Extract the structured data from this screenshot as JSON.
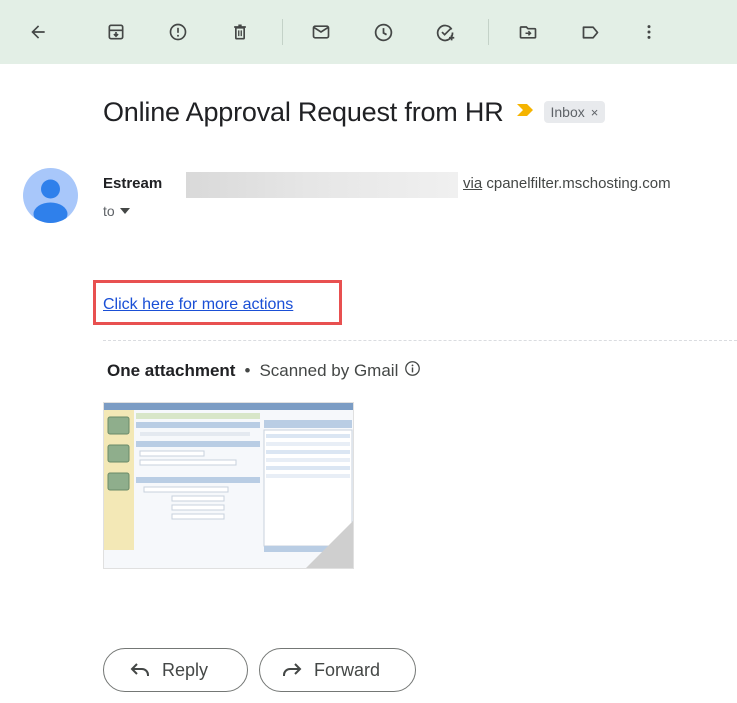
{
  "email": {
    "subject": "Online Approval Request from HR",
    "label": "Inbox",
    "label_close": "×",
    "sender_name": "Estream",
    "via_word": "via",
    "via_domain": "cpanelfilter.mschosting.com",
    "to_label": "to",
    "body_link": "Click here for more actions"
  },
  "attachments": {
    "count_label": "One attachment",
    "separator": "•",
    "scanned_label": "Scanned by Gmail"
  },
  "actions": {
    "reply_label": "Reply",
    "forward_label": "Forward"
  },
  "toolbar": {
    "icons": [
      "back-arrow-icon",
      "archive-icon",
      "report-spam-icon",
      "delete-icon",
      "mark-unread-icon",
      "snooze-icon",
      "add-to-tasks-icon",
      "move-to-icon",
      "labels-icon",
      "more-vert-icon"
    ]
  },
  "colors": {
    "toolbar_bg": "#e3efe6",
    "link": "#1a4fd6",
    "highlight": "#e85050",
    "importance": "#f5b400",
    "avatar": "#a8c7fa"
  }
}
